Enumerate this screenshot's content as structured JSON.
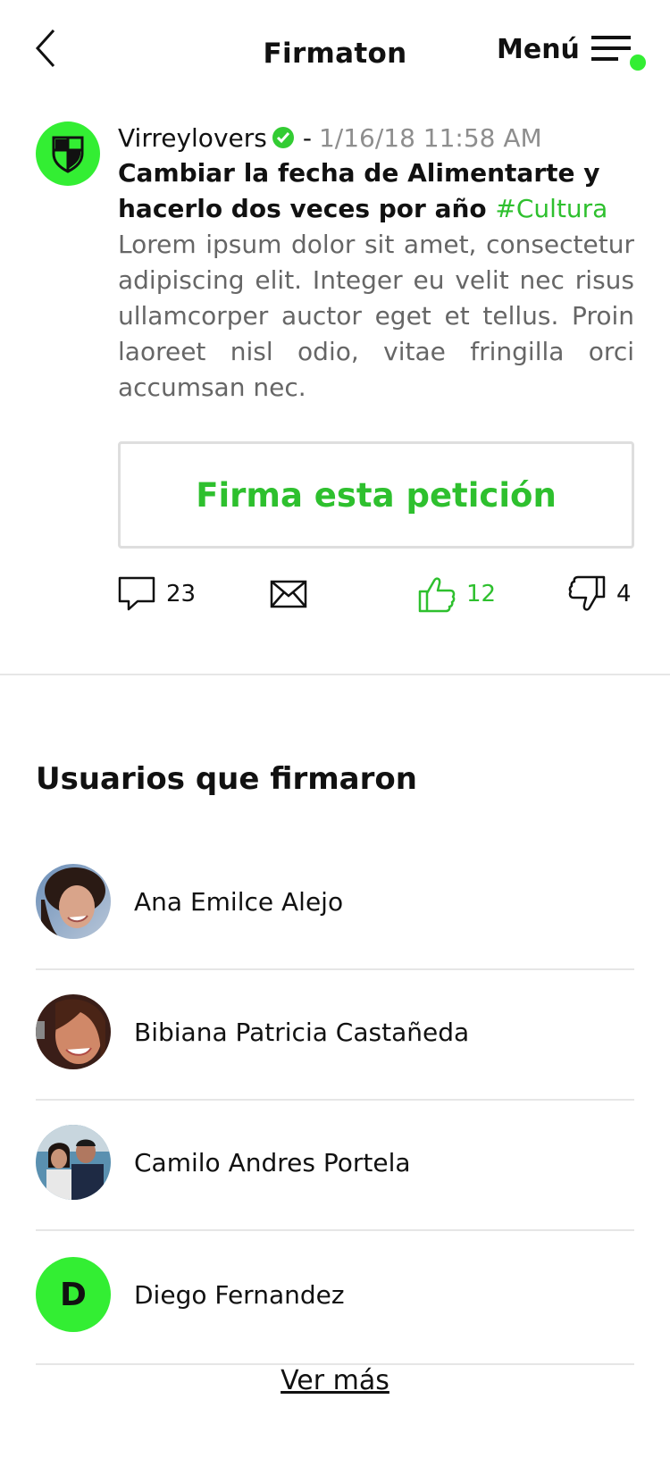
{
  "header": {
    "title": "Firmaton",
    "menu_label": "Menú",
    "accent_color": "#33ee33"
  },
  "post": {
    "author": "Virreylovers",
    "separator": "-",
    "date": "1/16/18 11:58 AM",
    "title": "Cambiar la fecha de Alimentarte y hacerlo dos veces por año",
    "hashtag": "#Cultura",
    "body": "Lorem ipsum dolor sit amet, consectetur adipiscing elit. Integer eu velit nec risus ullamcorper auctor eget et tellus. Proin laoreet nisl odio, vitae fringilla orci accumsan nec."
  },
  "sign_button": "Firma esta petición",
  "actions": {
    "comments": "23",
    "likes": "12",
    "dislikes": "4"
  },
  "signers_section": {
    "title": "Usuarios que firmaron",
    "items": [
      {
        "name": "Ana Emilce Alejo"
      },
      {
        "name": "Bibiana Patricia Castañeda"
      },
      {
        "name": "Camilo Andres Portela"
      },
      {
        "name": "Diego Fernandez",
        "initial": "D"
      }
    ],
    "more_label": "Ver más"
  }
}
